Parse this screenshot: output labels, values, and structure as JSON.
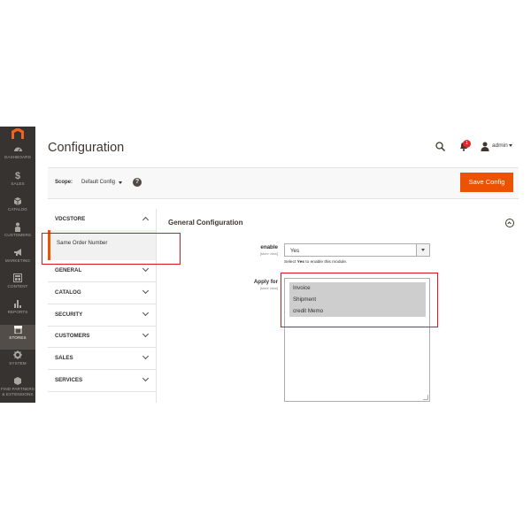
{
  "app": {
    "nav": [
      {
        "icon": "dashboard-icon",
        "label": "DASHBOARD"
      },
      {
        "icon": "dollar-icon",
        "label": "SALES",
        "glyph": "$"
      },
      {
        "icon": "catalog-icon",
        "label": "CATALOG"
      },
      {
        "icon": "customers-icon",
        "label": "CUSTOMERS"
      },
      {
        "icon": "megaphone-icon",
        "label": "MARKETING"
      },
      {
        "icon": "content-icon",
        "label": "CONTENT"
      },
      {
        "icon": "reports-icon",
        "label": "REPORTS"
      },
      {
        "icon": "stores-icon",
        "label": "STORES",
        "active": true
      },
      {
        "icon": "system-icon",
        "label": "SYSTEM"
      },
      {
        "icon": "partners-icon",
        "label_line1": "FIND PARTNERS",
        "label_line2": "& EXTENSIONS"
      }
    ]
  },
  "header": {
    "title": "Configuration",
    "notifications_count": "1",
    "username": "admin"
  },
  "scope": {
    "label": "Scope:",
    "value": "Default Config",
    "help": "?"
  },
  "toolbar": {
    "save_label": "Save Config"
  },
  "tabs": {
    "vdcstore": {
      "label": "VDCSTORE",
      "expanded": true,
      "items": [
        "Same Order Number"
      ]
    },
    "groups": [
      "GENERAL",
      "CATALOG",
      "SECURITY",
      "CUSTOMERS",
      "SALES",
      "SERVICES"
    ]
  },
  "section": {
    "title": "General Configuration"
  },
  "fields": {
    "enable": {
      "label": "enable",
      "scope": "[store view]",
      "value": "Yes",
      "note_prefix": "Select ",
      "note_bold": "Yes",
      "note_suffix": " to enable this module."
    },
    "apply_for": {
      "label": "Apply for",
      "scope": "[store view]",
      "options": [
        "Invoice",
        "Shipment",
        "credit Memo"
      ]
    }
  },
  "colors": {
    "accent": "#eb5202",
    "sidebar": "#373330",
    "annotation": "#e0141e"
  }
}
